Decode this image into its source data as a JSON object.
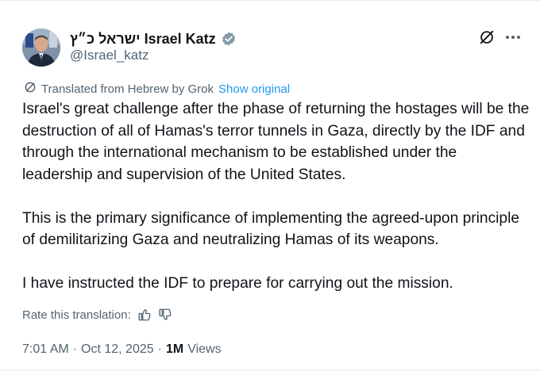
{
  "author": {
    "display_name": "ישראל כ״ץ Israel Katz",
    "handle": "@Israel_katz",
    "verified": true
  },
  "translation": {
    "label": "Translated from Hebrew by Grok",
    "show_original": "Show original"
  },
  "tweet": {
    "paragraphs": [
      "Israel's great challenge after the phase of returning the hostages will be the destruction of all of Hamas's terror tunnels in Gaza, directly by the IDF and through the international mechanism to be established under the leadership and supervision of the United States.",
      "This is the primary significance of implementing the agreed-upon principle of demilitarizing Gaza and neutralizing Hamas of its weapons.",
      "I have instructed the IDF to prepare for carrying out the mission."
    ]
  },
  "rate_translation": {
    "label": "Rate this translation:"
  },
  "meta": {
    "time": "7:01 AM",
    "date": "Oct 12, 2025",
    "views_count": "1M",
    "views_label": "Views",
    "separator": "·"
  },
  "icons": {
    "verified": "verified-badge-icon",
    "grok": "grok-icon",
    "more": "more-icon",
    "translate": "translate-icon",
    "thumbs_up": "thumbs-up-icon",
    "thumbs_down": "thumbs-down-icon"
  },
  "colors": {
    "accent": "#1d9bf0",
    "text_primary": "#0f1419",
    "text_secondary": "#536471"
  }
}
